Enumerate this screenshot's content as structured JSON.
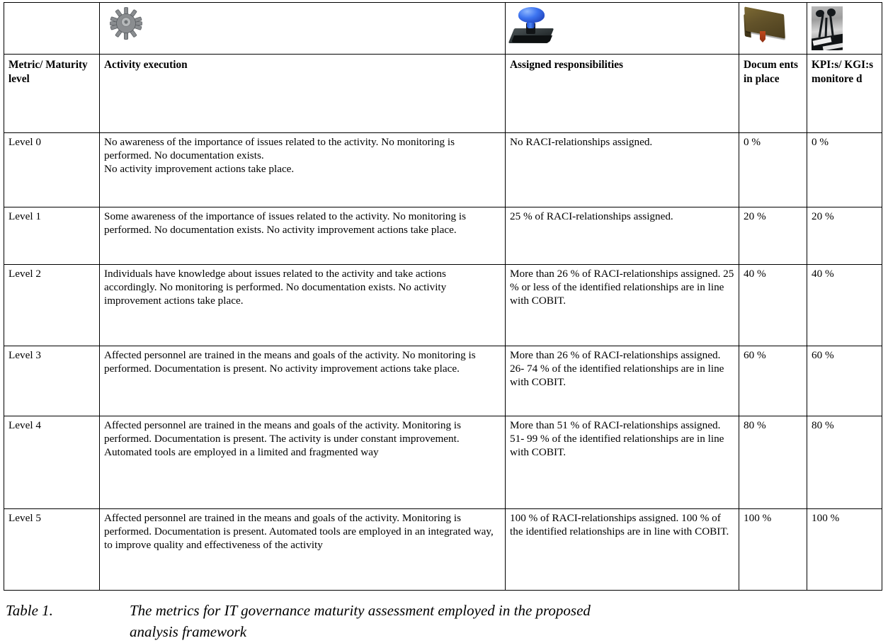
{
  "table": {
    "icon_row": {
      "level_icon": "",
      "activity_icon": "gear-icon",
      "responsibilities_icon": "stamp-icon",
      "documents_icon": "book-icon",
      "kpi_icon": "kpi-photo-icon"
    },
    "headers": {
      "level": "Metric/ Maturity level",
      "activity": "Activity execution",
      "responsibilities": "Assigned responsibilities",
      "documents": "Docum ents in place",
      "kpi": "KPI:s/ KGI:s monitore d"
    },
    "rows": [
      {
        "level": "Level 0",
        "activity": "No awareness of the importance of issues related to the activity. No monitoring is performed. No documentation exists.\nNo activity improvement actions take place.",
        "responsibilities": "No RACI-relationships assigned.",
        "documents": "0 %",
        "kpi": "0 %"
      },
      {
        "level": "Level 1",
        "activity": "Some awareness of the importance of issues related to the activity. No monitoring is performed. No documentation exists. No activity improvement actions take place.",
        "responsibilities": "25 % of RACI-relationships assigned.",
        "documents": "20 %",
        "kpi": "20 %"
      },
      {
        "level": "Level 2",
        "activity": "Individuals have knowledge about issues related to the activity and take actions accordingly. No monitoring is performed. No documentation exists. No activity improvement actions take place.",
        "responsibilities": "More than 26 % of RACI-relationships assigned. 25 % or less of the identified relationships are in line with COBIT.",
        "documents": "40 %",
        "kpi": "40 %"
      },
      {
        "level": "Level 3",
        "activity": "Affected personnel are trained in the means and goals of the activity. No monitoring is performed. Documentation is present. No activity improvement actions take place.",
        "responsibilities": "More than 26 % of RACI-relationships assigned. 26- 74 % of the identified relationships are in line with COBIT.",
        "documents": "60 %",
        "kpi": "60 %"
      },
      {
        "level": "Level 4",
        "activity": "Affected personnel are trained in the means and goals of the activity. Monitoring is performed. Documentation is present. The activity is under constant improvement. Automated tools are employed in a limited and fragmented way",
        "responsibilities": "More than 51 % of RACI-relationships assigned. 51- 99 % of the identified relationships are in line with COBIT.",
        "documents": "80 %",
        "kpi": "80 %"
      },
      {
        "level": "Level 5",
        "activity": "Affected personnel are trained in the means and goals of the activity. Monitoring is performed. Documentation is present. Automated tools are employed in an integrated way, to improve quality and effectiveness of the activity",
        "responsibilities": "100 % of RACI-relationships assigned. 100 % of the identified relationships are in line with COBIT.",
        "documents": "100 %",
        "kpi": "100 %"
      }
    ]
  },
  "caption": {
    "label": "Table 1.",
    "line1": "The metrics for IT governance maturity assessment employed in the proposed",
    "line2": "analysis framework"
  },
  "colors": {
    "border": "#000000",
    "text": "#000000",
    "background": "#ffffff",
    "gear": "#8a8d90",
    "stamp_handle": "#2f5fe0",
    "book_cover": "#63532a",
    "book_ribbon": "#b8421a"
  }
}
